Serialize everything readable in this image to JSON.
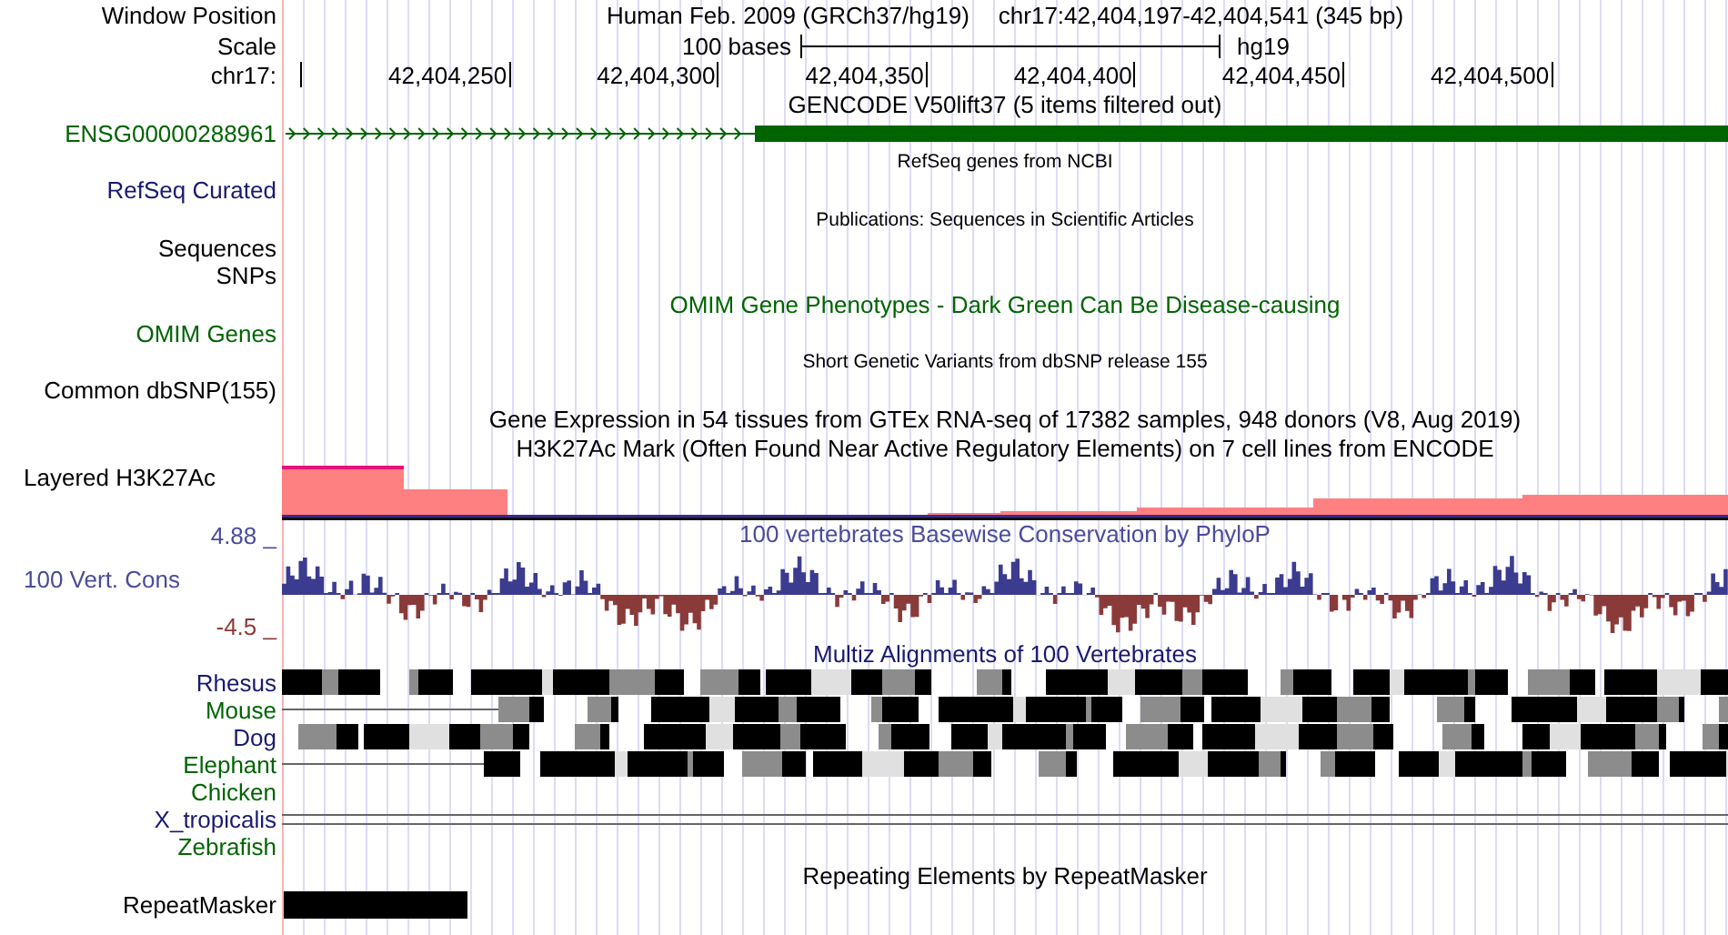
{
  "header": {
    "label": "Window Position",
    "assembly": "Human Feb. 2009 (GRCh37/hg19)",
    "position": "chr17:42,404,197-42,404,541 (345 bp)"
  },
  "scale": {
    "label": "Scale",
    "bar_label": "100 bases",
    "database": "hg19"
  },
  "ruler": {
    "label": "chr17:",
    "ticks": [
      "42,404,250",
      "42,404,300",
      "42,404,350",
      "42,404,400",
      "42,404,450",
      "42,404,500"
    ]
  },
  "rows": [
    {
      "kind": "title",
      "text": "GENCODE V50lift37 (5 items filtered out)",
      "color": "#000000"
    },
    {
      "kind": "gene",
      "label": "ENSG00000288961",
      "color": "#006400"
    },
    {
      "kind": "caption",
      "text": "RefSeq genes from NCBI",
      "color": "#000000"
    },
    {
      "kind": "empty",
      "label": "RefSeq Curated",
      "color": "#191970"
    },
    {
      "kind": "caption",
      "text": "Publications: Sequences in Scientific Articles",
      "color": "#000000"
    },
    {
      "kind": "empty",
      "label": "Sequences",
      "color": "#000000"
    },
    {
      "kind": "empty",
      "label": "SNPs",
      "color": "#000000"
    },
    {
      "kind": "title",
      "text": "OMIM Gene Phenotypes - Dark Green Can Be Disease-causing",
      "color": "#006400"
    },
    {
      "kind": "empty",
      "label": "OMIM Genes",
      "color": "#006400"
    },
    {
      "kind": "caption",
      "text": "Short Genetic Variants from dbSNP release 155",
      "color": "#000000"
    },
    {
      "kind": "empty",
      "label": "Common dbSNP(155)",
      "color": "#000000"
    },
    {
      "kind": "title",
      "text": "Gene Expression in 54 tissues from GTEx RNA-seq of 17382 samples, 948 donors (V8, Aug 2019)",
      "color": "#000000"
    },
    {
      "kind": "title",
      "text": "H3K27Ac Mark (Often Found Near Active Regulatory Elements) on 7 cell lines from ENCODE",
      "color": "#000000"
    },
    {
      "kind": "layered",
      "label": "Layered H3K27Ac",
      "color": "#000000"
    },
    {
      "kind": "conservation",
      "upper": "4.88 _",
      "label": "100 Vert. Cons",
      "lower": "-4.5 _",
      "title": "100 vertebrates Basewise Conservation by PhyloP",
      "color": "#4b4b9a"
    },
    {
      "kind": "title",
      "text": "Multiz Alignments of 100 Vertebrates",
      "color": "#191970"
    },
    {
      "kind": "alignment",
      "label": "Rhesus",
      "color": "#191970",
      "level": 1
    },
    {
      "kind": "alignment",
      "label": "Mouse",
      "color": "#006400",
      "level": 0.85
    },
    {
      "kind": "alignment",
      "label": "Dog",
      "color": "#191970",
      "level": 1
    },
    {
      "kind": "alignment",
      "label": "Elephant",
      "color": "#006400",
      "level": 0.86
    },
    {
      "kind": "empty",
      "label": "Chicken",
      "color": "#006400"
    },
    {
      "kind": "gap",
      "label": "X_tropicalis",
      "color": "#191970"
    },
    {
      "kind": "empty",
      "label": "Zebrafish",
      "color": "#006400"
    },
    {
      "kind": "title",
      "text": "Repeating Elements by RepeatMasker",
      "color": "#000000"
    },
    {
      "kind": "repeat",
      "label": "RepeatMasker",
      "color": "#000000"
    }
  ]
}
